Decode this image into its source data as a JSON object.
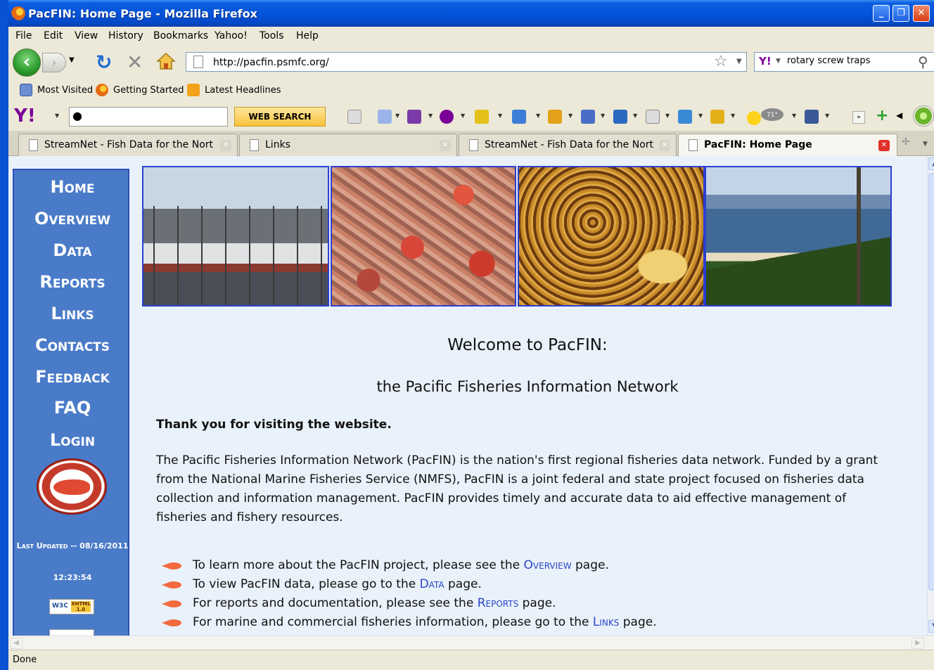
{
  "window": {
    "title": "PacFIN: Home Page - Mozilla Firefox"
  },
  "menu": [
    "File",
    "Edit",
    "View",
    "History",
    "Bookmarks",
    "Yahoo!",
    "Tools",
    "Help"
  ],
  "nav": {
    "url": "http://pacfin.psmfc.org/",
    "search_value": "rotary screw traps"
  },
  "bookmarks": [
    "Most Visited",
    "Getting Started",
    "Latest Headlines"
  ],
  "yahoo_toolbar": {
    "logo": "Y!",
    "search_value": "",
    "web_search_label": "WEB SEARCH",
    "weather": "71°"
  },
  "tabs": [
    {
      "label": "StreamNet - Fish Data for the Northw...",
      "active": false
    },
    {
      "label": "Links",
      "active": false
    },
    {
      "label": "StreamNet - Fish Data for the Northw...",
      "active": false
    },
    {
      "label": "PacFIN: Home Page",
      "active": true
    }
  ],
  "site_nav": {
    "items": [
      "Home",
      "Overview",
      "Data",
      "Reports",
      "Links",
      "Contacts",
      "Feedback",
      "FAQ",
      "Login"
    ],
    "last_updated": "Last Updated -- 08/16/2011",
    "update_time": "12:23:54",
    "w3c_label": "W3C",
    "w3c_tag": "XHTML 1.0"
  },
  "main": {
    "title": "Welcome to PacFIN:",
    "subtitle": "the Pacific Fisheries Information Network",
    "thanks": "Thank you for visiting the website.",
    "intro": "The Pacific Fisheries Information Network (PacFIN) is the nation's first regional fisheries data network. Funded by a grant from the National Marine Fisheries Service (NMFS), PacFIN is a joint federal and state project focused on fisheries data collection and information management. PacFIN provides timely and accurate data to aid effective management of fisheries and fishery resources.",
    "links": [
      {
        "before": "To learn more about the PacFIN project, please see the ",
        "link": "Overview",
        "after": " page."
      },
      {
        "before": "To view PacFIN data, please go to the ",
        "link": "Data",
        "after": " page."
      },
      {
        "before": "For reports and documentation, please see the ",
        "link": "Reports",
        "after": " page."
      },
      {
        "before": "For marine and commercial fisheries information, please go to the ",
        "link": "Links",
        "after": " page."
      }
    ]
  },
  "status": "Done",
  "colors": {
    "nav_bg": "#4a7bc8",
    "content_bg": "#e9f1fa",
    "link": "#2a45c8",
    "title_bar": "#0454d9"
  }
}
